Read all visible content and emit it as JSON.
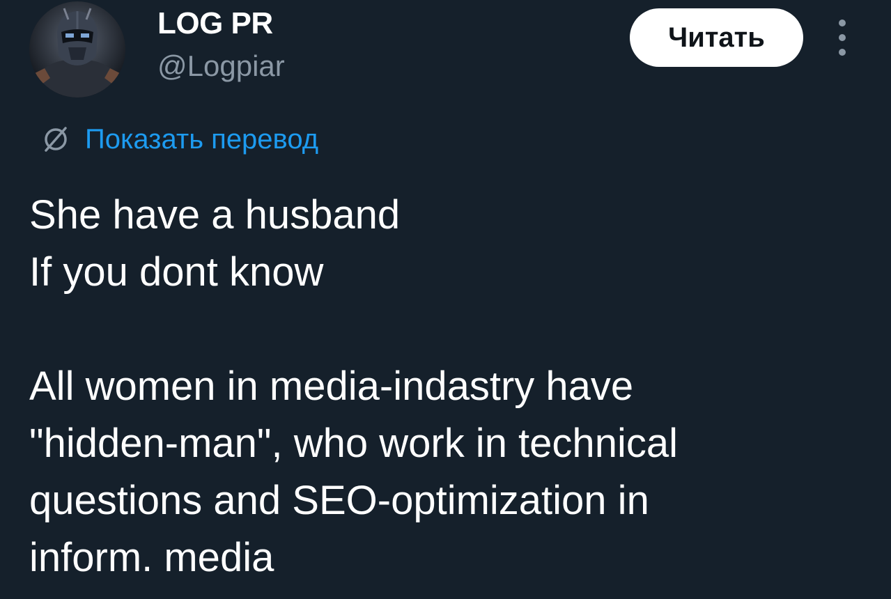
{
  "author": {
    "display_name": "LOG PR",
    "handle": "@Logpiar"
  },
  "actions": {
    "follow_label": "Читать",
    "more_icon": "more-vertical-icon"
  },
  "translation": {
    "icon": "translate-globe-icon",
    "label": "Показать перевод"
  },
  "tweet": {
    "text": "She have a husband\nIf you dont know\n\nAll women in media-indastry have\n\"hidden-man\", who work in technical\nquestions and SEO-optimization in\ninform. media"
  },
  "colors": {
    "background": "#15202b",
    "accent": "#1d9bf0",
    "muted": "#8b98a5"
  }
}
